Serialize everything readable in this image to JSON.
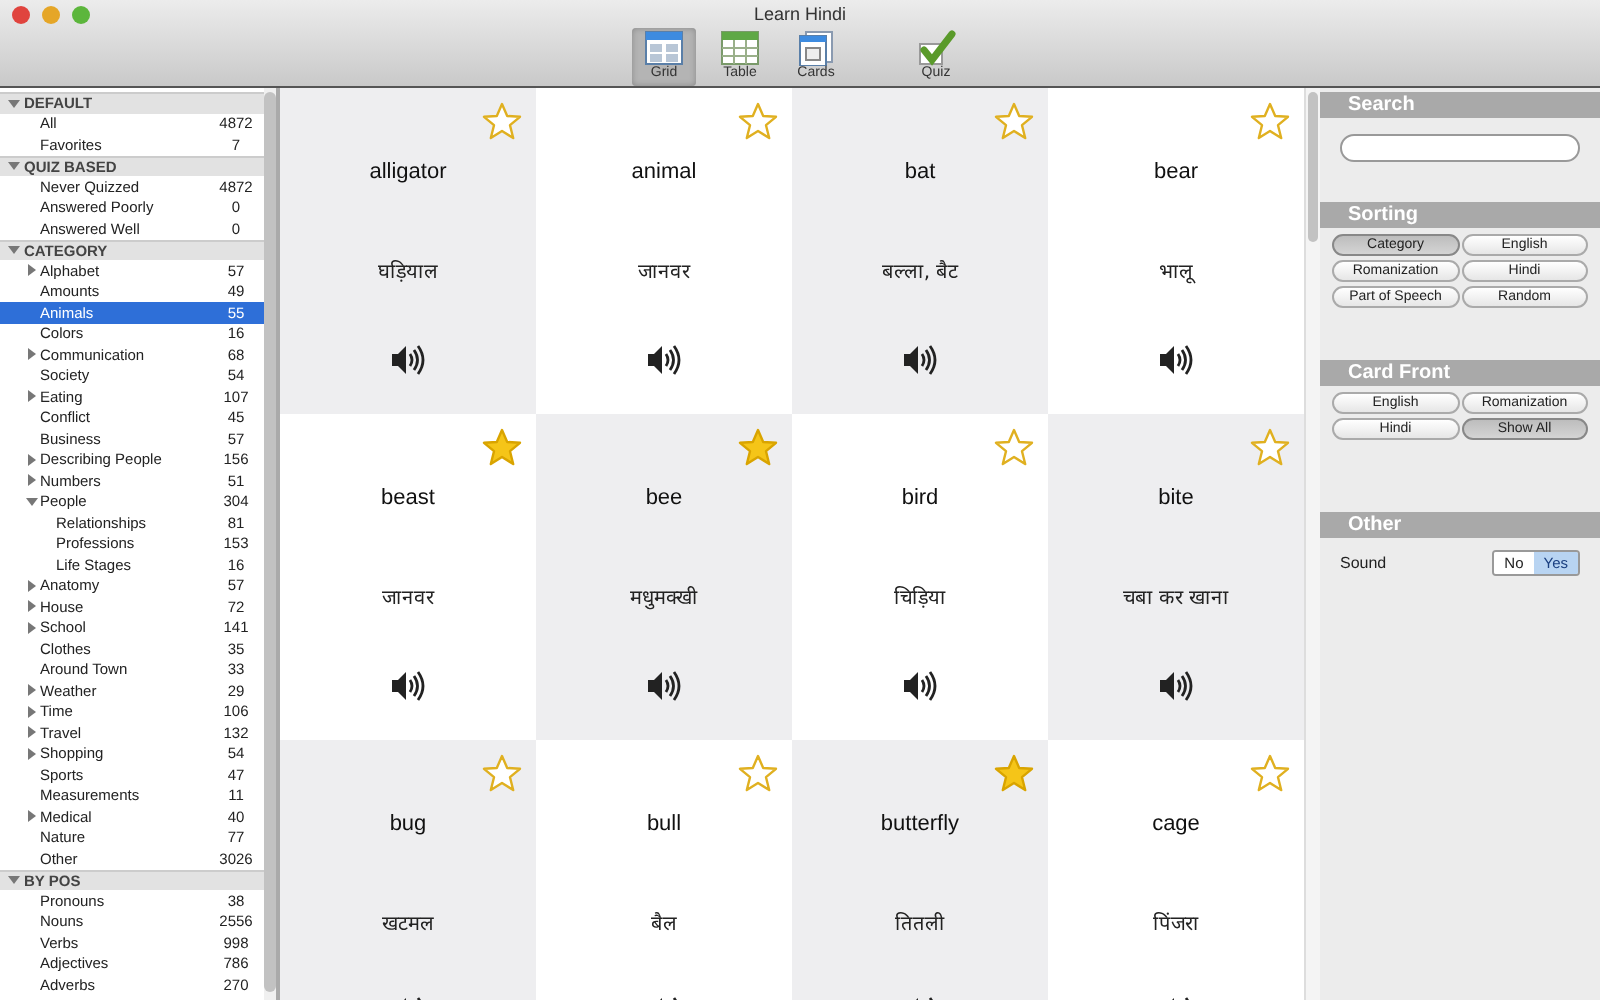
{
  "window": {
    "title": "Learn Hindi"
  },
  "toolbar": [
    {
      "label": "Grid",
      "kind": "grid",
      "selected": true
    },
    {
      "label": "Table",
      "kind": "table",
      "selected": false
    },
    {
      "label": "Cards",
      "kind": "cards",
      "selected": false
    },
    {
      "label": "Quiz",
      "kind": "quiz",
      "selected": false
    }
  ],
  "sidebar": {
    "groups": [
      {
        "title": "DEFAULT",
        "expanded": true,
        "items": [
          {
            "label": "All",
            "count": "4872",
            "selected": false
          },
          {
            "label": "Favorites",
            "count": "7",
            "selected": false
          }
        ]
      },
      {
        "title": "QUIZ BASED",
        "expanded": true,
        "items": [
          {
            "label": "Never Quizzed",
            "count": "4872",
            "selected": false
          },
          {
            "label": "Answered Poorly",
            "count": "0",
            "selected": false
          },
          {
            "label": "Answered Well",
            "count": "0",
            "selected": false
          }
        ]
      },
      {
        "title": "CATEGORY",
        "expanded": true,
        "items": [
          {
            "label": "Alphabet",
            "count": "57",
            "selected": false,
            "expanded": false
          },
          {
            "label": "Amounts",
            "count": "49",
            "selected": false
          },
          {
            "label": "Animals",
            "count": "55",
            "selected": true
          },
          {
            "label": "Colors",
            "count": "16",
            "selected": false
          },
          {
            "label": "Communication",
            "count": "68",
            "selected": false,
            "expanded": false
          },
          {
            "label": "Society",
            "count": "54",
            "selected": false
          },
          {
            "label": "Eating",
            "count": "107",
            "selected": false,
            "expanded": false
          },
          {
            "label": "Conflict",
            "count": "45",
            "selected": false
          },
          {
            "label": "Business",
            "count": "57",
            "selected": false
          },
          {
            "label": "Describing People",
            "count": "156",
            "selected": false,
            "expanded": false
          },
          {
            "label": "Numbers",
            "count": "51",
            "selected": false,
            "expanded": false
          },
          {
            "label": "People",
            "count": "304",
            "selected": false,
            "expanded": true,
            "children": [
              {
                "label": "Relationships",
                "count": "81",
                "selected": false
              },
              {
                "label": "Professions",
                "count": "153",
                "selected": false
              },
              {
                "label": "Life Stages",
                "count": "16",
                "selected": false
              }
            ]
          },
          {
            "label": "Anatomy",
            "count": "57",
            "selected": false,
            "expanded": false
          },
          {
            "label": "House",
            "count": "72",
            "selected": false,
            "expanded": false
          },
          {
            "label": "School",
            "count": "141",
            "selected": false,
            "expanded": false
          },
          {
            "label": "Clothes",
            "count": "35",
            "selected": false
          },
          {
            "label": "Around Town",
            "count": "33",
            "selected": false
          },
          {
            "label": "Weather",
            "count": "29",
            "selected": false,
            "expanded": false
          },
          {
            "label": "Time",
            "count": "106",
            "selected": false,
            "expanded": false
          },
          {
            "label": "Travel",
            "count": "132",
            "selected": false,
            "expanded": false
          },
          {
            "label": "Shopping",
            "count": "54",
            "selected": false,
            "expanded": false
          },
          {
            "label": "Sports",
            "count": "47",
            "selected": false
          },
          {
            "label": "Measurements",
            "count": "11",
            "selected": false
          },
          {
            "label": "Medical",
            "count": "40",
            "selected": false,
            "expanded": false
          },
          {
            "label": "Nature",
            "count": "77",
            "selected": false
          },
          {
            "label": "Other",
            "count": "3026",
            "selected": false
          }
        ]
      },
      {
        "title": "BY POS",
        "expanded": true,
        "items": [
          {
            "label": "Pronouns",
            "count": "38",
            "selected": false
          },
          {
            "label": "Nouns",
            "count": "2556",
            "selected": false
          },
          {
            "label": "Verbs",
            "count": "998",
            "selected": false
          },
          {
            "label": "Adjectives",
            "count": "786",
            "selected": false
          },
          {
            "label": "Adverbs",
            "count": "270",
            "selected": false
          }
        ]
      }
    ]
  },
  "cards": [
    {
      "english": "alligator",
      "hindi": "घड़ियाल",
      "favorite": false
    },
    {
      "english": "animal",
      "hindi": "जानवर",
      "favorite": false
    },
    {
      "english": "bat",
      "hindi": "बल्ला, बैट",
      "favorite": false
    },
    {
      "english": "bear",
      "hindi": "भालू",
      "favorite": false
    },
    {
      "english": "beast",
      "hindi": "जानवर",
      "favorite": true
    },
    {
      "english": "bee",
      "hindi": "मधुमक्खी",
      "favorite": true
    },
    {
      "english": "bird",
      "hindi": "चिड़िया",
      "favorite": false
    },
    {
      "english": "bite",
      "hindi": "चबा कर खाना",
      "favorite": false
    },
    {
      "english": "bug",
      "hindi": "खटमल",
      "favorite": false
    },
    {
      "english": "bull",
      "hindi": "बैल",
      "favorite": false
    },
    {
      "english": "butterfly",
      "hindi": "तितली",
      "favorite": true
    },
    {
      "english": "cage",
      "hindi": "पिंजरा",
      "favorite": false
    }
  ],
  "panel": {
    "search": {
      "title": "Search"
    },
    "sorting": {
      "title": "Sorting",
      "options": [
        {
          "label": "Category",
          "selected": true
        },
        {
          "label": "English",
          "selected": false
        },
        {
          "label": "Romanization",
          "selected": false
        },
        {
          "label": "Hindi",
          "selected": false
        },
        {
          "label": "Part of Speech",
          "selected": false
        },
        {
          "label": "Random",
          "selected": false
        }
      ]
    },
    "card_front": {
      "title": "Card Front",
      "options": [
        {
          "label": "English",
          "selected": false
        },
        {
          "label": "Romanization",
          "selected": false
        },
        {
          "label": "Hindi",
          "selected": false
        },
        {
          "label": "Show All",
          "selected": true
        }
      ]
    },
    "other": {
      "title": "Other",
      "sound": {
        "label": "Sound",
        "options": [
          {
            "label": "No",
            "selected": false
          },
          {
            "label": "Yes",
            "selected": true
          }
        ]
      }
    }
  }
}
